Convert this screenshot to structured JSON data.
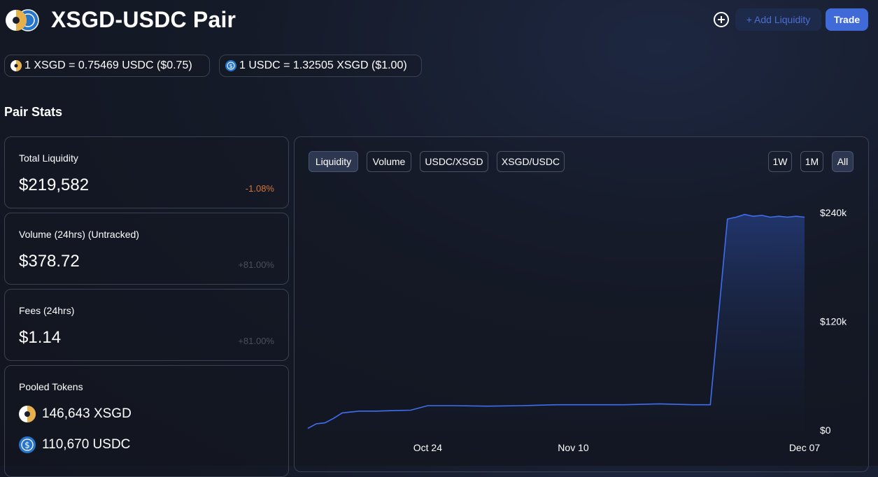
{
  "header": {
    "title": "XSGD-USDC Pair",
    "add_liquidity_label": "+ Add Liquidity",
    "trade_label": "Trade",
    "icons": [
      "xsgd-usdc-pair-logo",
      "add-circle-icon"
    ]
  },
  "rates": [
    {
      "icon": "xsgd-token-icon",
      "text": "1 XSGD = 0.75469 USDC ($0.75)"
    },
    {
      "icon": "usdc-token-icon",
      "text": "1 USDC = 1.32505 XSGD ($1.00)"
    }
  ],
  "pair_stats": {
    "title": "Pair Stats",
    "total_liquidity": {
      "label": "Total Liquidity",
      "value": "$219,582",
      "change": "-1.08%"
    },
    "volume": {
      "label": "Volume (24hrs) (Untracked)",
      "value": "$378.72",
      "change": "+81.00%"
    },
    "fees": {
      "label": "Fees (24hrs)",
      "value": "$1.14",
      "change": "+81.00%"
    },
    "pooled": {
      "label": "Pooled Tokens",
      "tokens": [
        {
          "icon": "xsgd-token-icon",
          "text": "146,643 XSGD"
        },
        {
          "icon": "usdc-token-icon",
          "text": "110,670 USDC"
        }
      ]
    }
  },
  "chart_tabs": [
    "Liquidity",
    "Volume",
    "USDC/XSGD",
    "XSGD/USDC"
  ],
  "active_tab": "Liquidity",
  "range_tabs": [
    "1W",
    "1M",
    "All"
  ],
  "active_range": "All",
  "colors": {
    "accent": "#3f6ad8",
    "line": "#3e6ff0",
    "negative": "#d4763a",
    "xsgd": "#e8b04a",
    "usdc": "#2775ca"
  },
  "chart_data": {
    "type": "area",
    "y_tick_labels": [
      "$240k",
      "$120k",
      "$0"
    ],
    "x_tick_labels": [
      "Oct 24",
      "Nov 10",
      "Dec 07"
    ],
    "ylim": [
      0,
      240000
    ],
    "x_dates": [
      "Oct 10",
      "Oct 11",
      "Oct 12",
      "Oct 13",
      "Oct 14",
      "Oct 15",
      "Oct 16",
      "Oct 18",
      "Oct 20",
      "Oct 22",
      "Oct 24",
      "Oct 27",
      "Oct 31",
      "Nov 04",
      "Nov 08",
      "Nov 12",
      "Nov 16",
      "Nov 20",
      "Nov 24",
      "Nov 26",
      "Nov 28",
      "Nov 29",
      "Nov 30",
      "Dec 01",
      "Dec 02",
      "Dec 03",
      "Dec 04",
      "Dec 05",
      "Dec 06",
      "Dec 07"
    ],
    "values": [
      2000,
      7000,
      8000,
      13000,
      19000,
      20000,
      21000,
      21000,
      21500,
      22000,
      27000,
      27000,
      26500,
      27000,
      28000,
      28000,
      28000,
      29000,
      28000,
      28000,
      233000,
      235000,
      238000,
      236000,
      237000,
      235000,
      236000,
      235000,
      236000,
      235000
    ],
    "series": [
      {
        "name": "Liquidity"
      }
    ]
  }
}
